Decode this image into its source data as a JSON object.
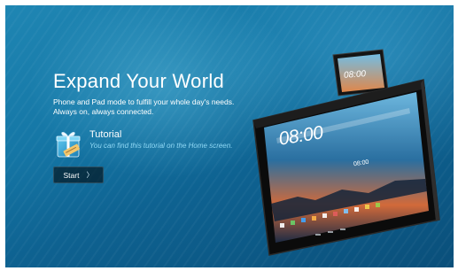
{
  "page": {
    "headline": "Expand Your World",
    "description_line1": "Phone and Pad mode to fulfill your whole day's needs.",
    "description_line2": "Always on, always connected."
  },
  "tutorial": {
    "icon": "gift-tutorial-icon",
    "title": "Tutorial",
    "description": "You can find this tutorial on the Home screen."
  },
  "start_button": {
    "label": "Start",
    "chevron": "〉"
  },
  "devices": {
    "tablet_clock": "08:00",
    "tablet_time_small": "08:00",
    "phone_clock": "08:00"
  },
  "colors": {
    "background": "#1577a6",
    "accent_text": "#8fd8f5",
    "button_bg": "#000000"
  }
}
